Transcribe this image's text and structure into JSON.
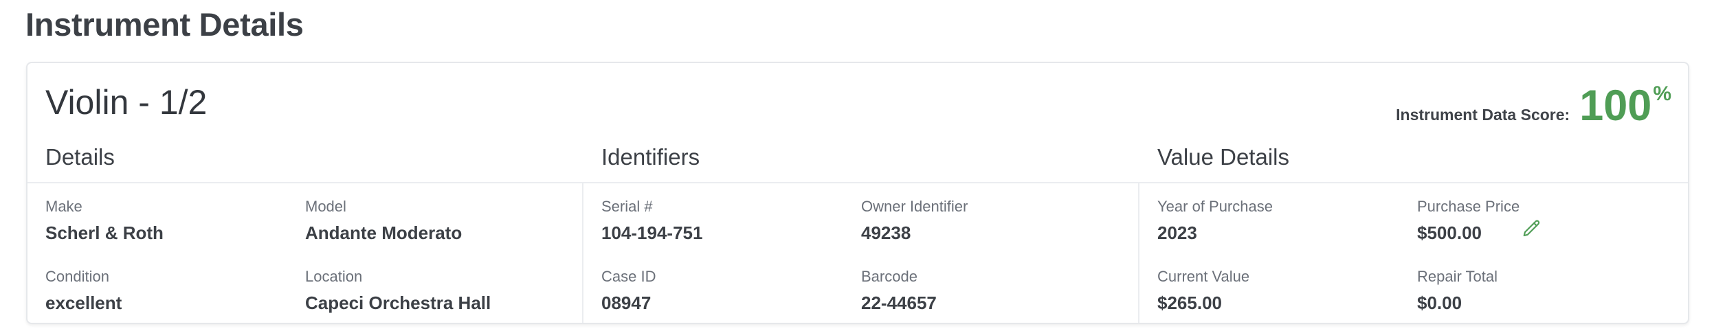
{
  "page": {
    "title": "Instrument Details"
  },
  "instrument": {
    "name": "Violin - 1/2"
  },
  "score": {
    "label": "Instrument Data Score:",
    "value": "100",
    "unit": "%",
    "color": "#4f9d55"
  },
  "sections": {
    "details": {
      "title": "Details",
      "make_label": "Make",
      "make_value": "Scherl & Roth",
      "model_label": "Model",
      "model_value": "Andante Moderato",
      "condition_label": "Condition",
      "condition_value": "excellent",
      "location_label": "Location",
      "location_value": "Capeci Orchestra Hall"
    },
    "identifiers": {
      "title": "Identifiers",
      "serial_label": "Serial #",
      "serial_value": "104-194-751",
      "owner_label": "Owner Identifier",
      "owner_value": "49238",
      "case_label": "Case ID",
      "case_value": "08947",
      "barcode_label": "Barcode",
      "barcode_value": "22-44657"
    },
    "value": {
      "title": "Value Details",
      "year_label": "Year of Purchase",
      "year_value": "2023",
      "price_label": "Purchase Price",
      "price_value": "$500.00",
      "current_label": "Current Value",
      "current_value": "$265.00",
      "repair_label": "Repair Total",
      "repair_value": "$0.00",
      "edit_icon": "pencil-icon"
    }
  }
}
